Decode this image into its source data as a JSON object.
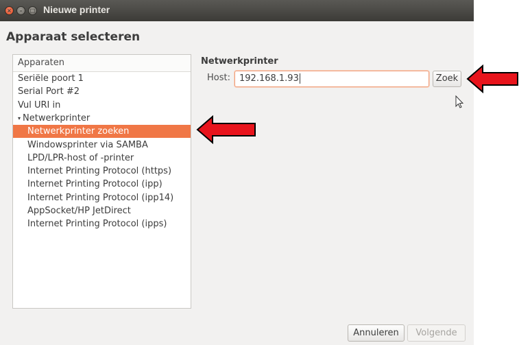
{
  "window": {
    "title": "Nieuwe printer"
  },
  "page": {
    "heading": "Apparaat selecteren"
  },
  "devices": {
    "header": "Apparaten",
    "items": [
      {
        "label": "Seriële poort 1",
        "level": 0,
        "selected": false
      },
      {
        "label": "Serial Port #2",
        "level": 0,
        "selected": false
      },
      {
        "label": "Vul URI in",
        "level": 0,
        "selected": false
      },
      {
        "label": "Netwerkprinter",
        "level": 0,
        "selected": false,
        "expanded": true
      },
      {
        "label": "Netwerkprinter zoeken",
        "level": 1,
        "selected": true
      },
      {
        "label": "Windowsprinter via SAMBA",
        "level": 1,
        "selected": false
      },
      {
        "label": "LPD/LPR-host of -printer",
        "level": 1,
        "selected": false
      },
      {
        "label": "Internet Printing Protocol (https)",
        "level": 1,
        "selected": false
      },
      {
        "label": "Internet Printing Protocol (ipp)",
        "level": 1,
        "selected": false
      },
      {
        "label": "Internet Printing Protocol (ipp14)",
        "level": 1,
        "selected": false
      },
      {
        "label": "AppSocket/HP JetDirect",
        "level": 1,
        "selected": false
      },
      {
        "label": "Internet Printing Protocol (ipps)",
        "level": 1,
        "selected": false
      }
    ]
  },
  "network": {
    "section_title": "Netwerkprinter",
    "host_label": "Host:",
    "host_value": "192.168.1.93",
    "search_button": "Zoek"
  },
  "footer": {
    "cancel": "Annuleren",
    "next": "Volgende"
  },
  "colors": {
    "selection": "#f07746",
    "arrow": "#e8141c",
    "titlebar": "#3c3b37"
  },
  "icons": {
    "close": "close-icon",
    "minimize": "minimize-icon",
    "maximize": "maximize-icon",
    "pointer": "mouse-pointer-icon",
    "arrow": "red-arrow-annotation"
  }
}
